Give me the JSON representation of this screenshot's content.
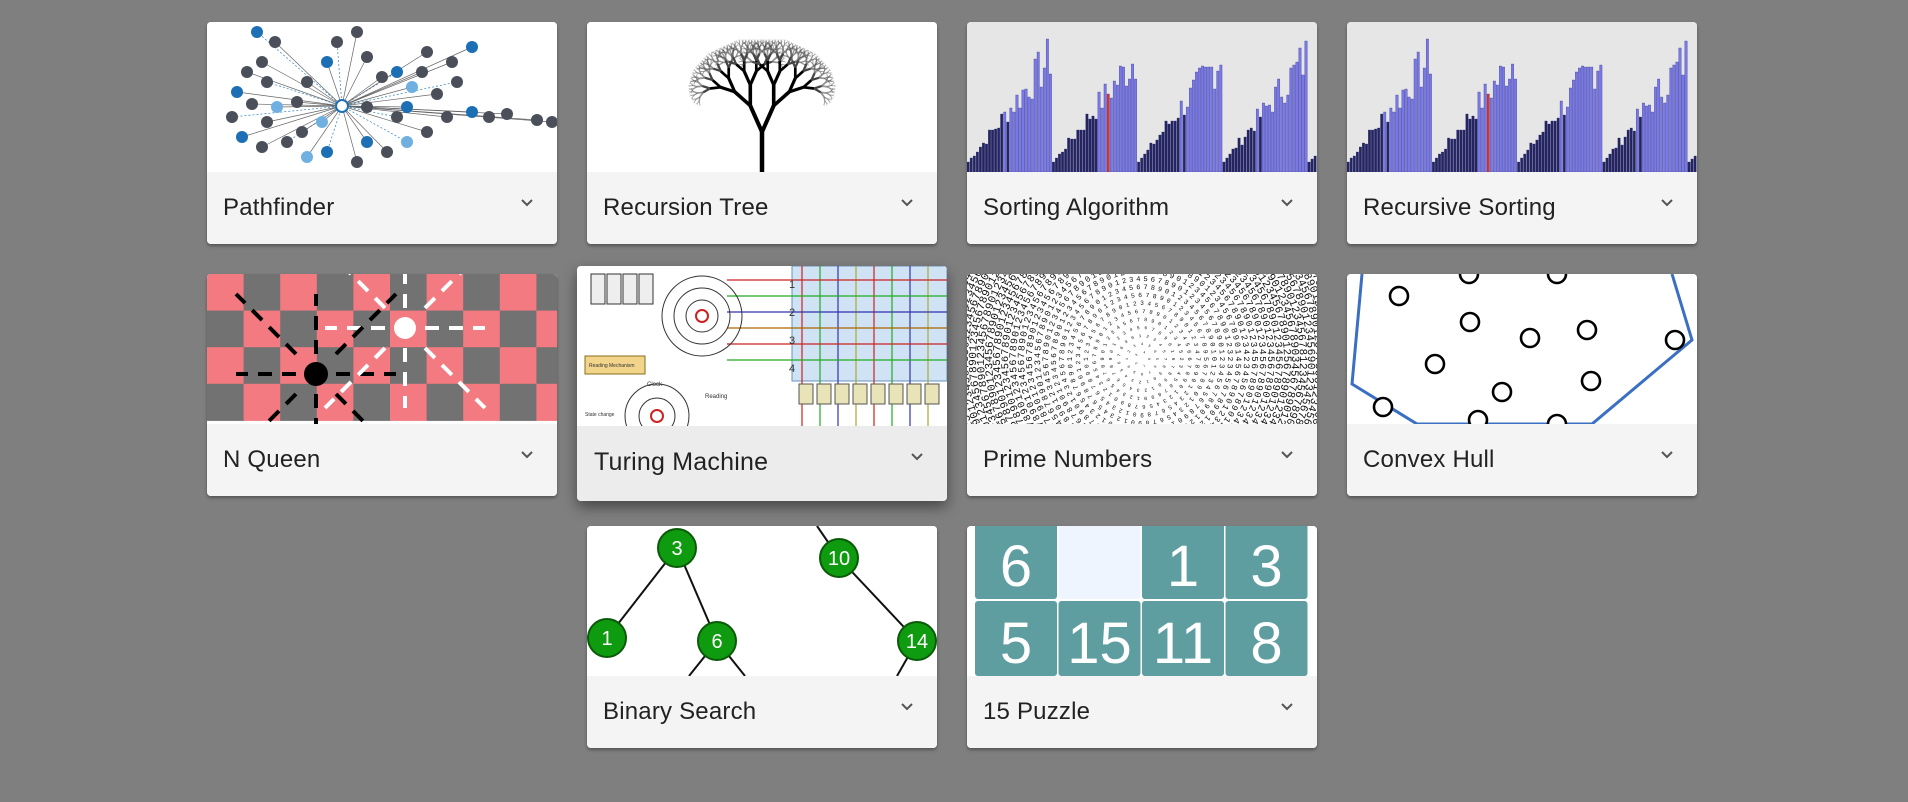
{
  "cards": [
    {
      "title": "Pathfinder",
      "icon": "pathfinder-graph-thumbnail"
    },
    {
      "title": "Recursion Tree",
      "icon": "fractal-tree-thumbnail"
    },
    {
      "title": "Sorting Algorithm",
      "icon": "bar-sort-thumbnail"
    },
    {
      "title": "Recursive Sorting",
      "icon": "bar-sort-thumbnail"
    },
    {
      "title": "N Queen",
      "icon": "chessboard-queen-thumbnail"
    },
    {
      "title": "Turing Machine",
      "icon": "turing-machine-diagram-thumbnail"
    },
    {
      "title": "Prime Numbers",
      "icon": "number-spiral-thumbnail"
    },
    {
      "title": "Convex Hull",
      "icon": "convex-hull-thumbnail"
    },
    {
      "title": "Binary Search",
      "icon": "binary-tree-thumbnail"
    },
    {
      "title": "15 Puzzle",
      "icon": "sliding-puzzle-thumbnail"
    }
  ],
  "binary_tree_nodes": [
    "3",
    "10",
    "1",
    "6",
    "14"
  ],
  "puzzle_tiles": [
    "6",
    "",
    "1",
    "3",
    "5",
    "15",
    "11",
    "8"
  ],
  "turing_labels": {
    "numbers": [
      "1",
      "2",
      "3",
      "4"
    ],
    "clock": "Clock",
    "reading": "Reading",
    "reading_mech": "Reading Mechanism",
    "state_change": "State change"
  },
  "colors": {
    "background": "#7f7f7f",
    "card": "#f4f4f4",
    "node_green": "#0f9b0f",
    "tile_teal": "#5f9ea0",
    "bar_blue": "#6f6fe8",
    "queen_red": "#f37a80"
  }
}
